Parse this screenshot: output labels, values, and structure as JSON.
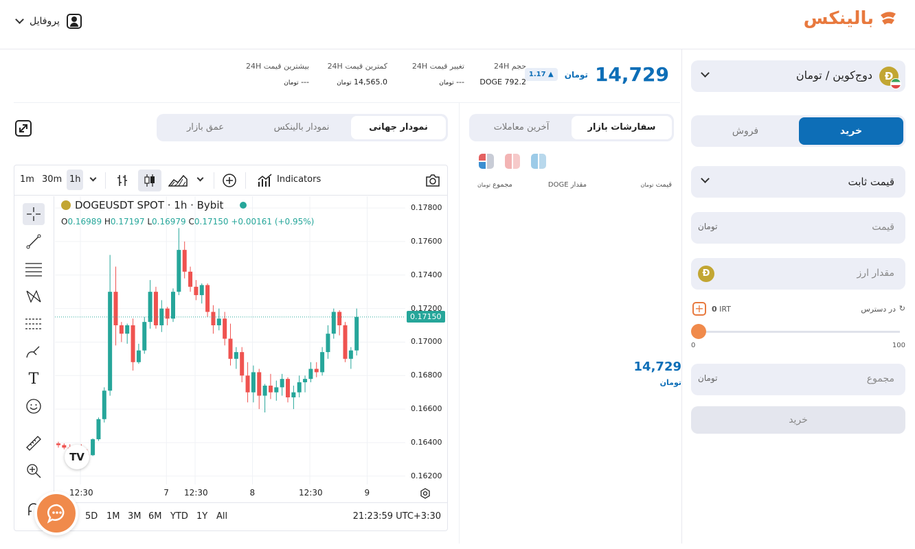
{
  "header": {
    "logo_text": "بالینکس",
    "profile_label": "پروفایل"
  },
  "ticker": {
    "price": "14,729",
    "currency_suffix": "تومان",
    "change_percent": "1.17",
    "stats": [
      {
        "label": "حجم 24H",
        "value": "DOGE 792.2"
      },
      {
        "label": "تغییر قیمت 24H",
        "value": "---"
      },
      {
        "label": "کمترین قیمت 24H",
        "value": "14,565.0"
      },
      {
        "label": "بیشترین قیمت 24H",
        "value": "---"
      }
    ]
  },
  "trade_panel": {
    "pair_name": "دوج‌کوین / تومان",
    "buy_tab": "خرید",
    "sell_tab": "فروش",
    "order_type": "قیمت ثابت",
    "price_placeholder": "قیمت",
    "amount_placeholder": "مقدار ارز",
    "available_label": "در دسترس",
    "available_value": "0",
    "available_unit": "IRT",
    "slider_min": "0",
    "slider_max": "100",
    "slider_value_percent": 0,
    "total_placeholder": "مجموع",
    "submit_label": "خرید",
    "coin_letter": "Ð"
  },
  "orderbook": {
    "tab_active": "سفارشات بازار",
    "tab_other": "آخرین معاملات",
    "col_price": "قیمت",
    "col_amount": "مقدار DOGE",
    "col_total": "مجموع",
    "mid_price": "14,729"
  },
  "chart_tabs": {
    "global": "نمودار جهانی",
    "balinex": "نمودار بالینکس",
    "depth": "عمق بازار"
  },
  "tv": {
    "intervals": [
      "1m",
      "30m",
      "1h"
    ],
    "indicators_label": "Indicators",
    "symbol_title": "DOGEUSDT SPOT · 1h · Bybit",
    "ohlc": {
      "o": "0.16989",
      "h": "0.17197",
      "l": "0.16979",
      "c": "0.17150",
      "chg": "+0.00161 (+0.95%)"
    },
    "last_price_label": "0.17150",
    "yticks": [
      "0.17800",
      "0.17600",
      "0.17400",
      "0.17200",
      "0.17000",
      "0.16800",
      "0.16600",
      "0.16400",
      "0.16200"
    ],
    "xticks": [
      "12:30",
      "7",
      "12:30",
      "8",
      "12:30",
      "9"
    ],
    "ranges": [
      "5D",
      "1M",
      "3M",
      "6M",
      "YTD",
      "1Y",
      "All"
    ],
    "clock": "21:23:59 UTC+3:30",
    "colors": {
      "up": "#26a69a",
      "down": "#ef5350"
    }
  },
  "chart_data": {
    "type": "candlestick",
    "title": "DOGEUSDT SPOT · 1h · Bybit",
    "ylim": [
      0.1615,
      0.1787
    ],
    "x_index_range": [
      0,
      52
    ],
    "candles": [
      [
        0.16395,
        0.16405,
        0.1637,
        0.16385
      ],
      [
        0.16385,
        0.16395,
        0.1636,
        0.1637
      ],
      [
        0.1637,
        0.1639,
        0.1634,
        0.16345
      ],
      [
        0.16345,
        0.16385,
        0.1633,
        0.1637
      ],
      [
        0.1637,
        0.1639,
        0.1632,
        0.1633
      ],
      [
        0.1633,
        0.1636,
        0.163,
        0.16325
      ],
      [
        0.16325,
        0.16425,
        0.1632,
        0.1642
      ],
      [
        0.1642,
        0.1655,
        0.1641,
        0.1654
      ],
      [
        0.1654,
        0.1673,
        0.1652,
        0.1671
      ],
      [
        0.1671,
        0.1752,
        0.1668,
        0.173
      ],
      [
        0.173,
        0.1745,
        0.1698,
        0.171
      ],
      [
        0.171,
        0.1712,
        0.17,
        0.1705
      ],
      [
        0.1705,
        0.1711,
        0.1699,
        0.171
      ],
      [
        0.171,
        0.1714,
        0.1683,
        0.1688
      ],
      [
        0.1688,
        0.1699,
        0.1687,
        0.1695
      ],
      [
        0.1695,
        0.1715,
        0.1693,
        0.1712
      ],
      [
        0.1712,
        0.1737,
        0.1708,
        0.173
      ],
      [
        0.173,
        0.1733,
        0.1708,
        0.171
      ],
      [
        0.171,
        0.1725,
        0.1706,
        0.172
      ],
      [
        0.172,
        0.1721,
        0.171,
        0.1714
      ],
      [
        0.1714,
        0.1732,
        0.1712,
        0.173
      ],
      [
        0.173,
        0.1768,
        0.1728,
        0.1755
      ],
      [
        0.1755,
        0.176,
        0.1738,
        0.1742
      ],
      [
        0.1742,
        0.1745,
        0.173,
        0.1733
      ],
      [
        0.1733,
        0.1737,
        0.1725,
        0.1728
      ],
      [
        0.1728,
        0.1735,
        0.1723,
        0.1734
      ],
      [
        0.1734,
        0.1735,
        0.1715,
        0.1718
      ],
      [
        0.1718,
        0.1722,
        0.1705,
        0.171
      ],
      [
        0.171,
        0.172,
        0.1707,
        0.1714
      ],
      [
        0.1714,
        0.1718,
        0.1698,
        0.1702
      ],
      [
        0.1702,
        0.1711,
        0.1686,
        0.169
      ],
      [
        0.169,
        0.1697,
        0.1684,
        0.1694
      ],
      [
        0.1694,
        0.1697,
        0.1676,
        0.168
      ],
      [
        0.168,
        0.1688,
        0.1664,
        0.167
      ],
      [
        0.167,
        0.1686,
        0.1664,
        0.1682
      ],
      [
        0.1682,
        0.1684,
        0.166,
        0.1668
      ],
      [
        0.1668,
        0.1675,
        0.1658,
        0.1674
      ],
      [
        0.1674,
        0.1681,
        0.1666,
        0.167
      ],
      [
        0.167,
        0.1677,
        0.1665,
        0.1673
      ],
      [
        0.1673,
        0.1681,
        0.1668,
        0.1678
      ],
      [
        0.1678,
        0.1679,
        0.1664,
        0.1667
      ],
      [
        0.1667,
        0.1674,
        0.166,
        0.167
      ],
      [
        0.167,
        0.168,
        0.1667,
        0.1676
      ],
      [
        0.1676,
        0.168,
        0.167,
        0.1678
      ],
      [
        0.1678,
        0.1688,
        0.1676,
        0.1684
      ],
      [
        0.1684,
        0.1688,
        0.1679,
        0.1682
      ],
      [
        0.1682,
        0.1697,
        0.168,
        0.1694
      ],
      [
        0.1694,
        0.171,
        0.169,
        0.1705
      ],
      [
        0.1705,
        0.172,
        0.1702,
        0.1718
      ],
      [
        0.1718,
        0.1719,
        0.1704,
        0.171
      ],
      [
        0.171,
        0.1712,
        0.1688,
        0.169
      ],
      [
        0.169,
        0.1697,
        0.1684,
        0.1695
      ],
      [
        0.1695,
        0.172,
        0.1692,
        0.1715
      ]
    ]
  }
}
